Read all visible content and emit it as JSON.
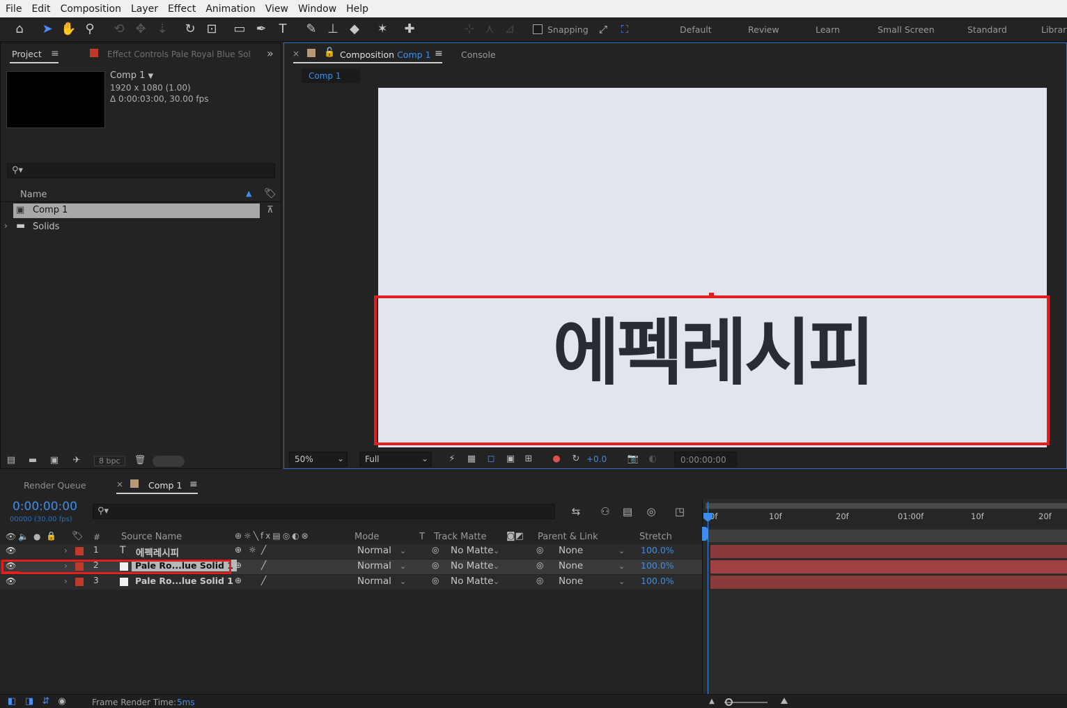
{
  "menu": [
    "File",
    "Edit",
    "Composition",
    "Layer",
    "Effect",
    "Animation",
    "View",
    "Window",
    "Help"
  ],
  "toolbar": {
    "snapping_label": "Snapping",
    "workspaces": [
      "Default",
      "Review",
      "Learn",
      "Small Screen",
      "Standard",
      "Librar"
    ]
  },
  "project_panel": {
    "tab_label": "Project",
    "effect_controls_label": "Effect Controls",
    "effect_controls_target": "Pale Royal Blue Sol",
    "comp_name": "Comp 1",
    "comp_size": "1920 x 1080 (1.00)",
    "comp_duration": "Δ 0:00:03:00, 30.00 fps",
    "search_placeholder": "",
    "name_header": "Name",
    "items": [
      "Comp 1",
      "Solids"
    ],
    "bpc": "8 bpc"
  },
  "comp_panel": {
    "tab_prefix": "Composition",
    "tab_comp": "Comp 1",
    "console_tab": "Console",
    "sub_tab": "Comp 1",
    "text": "에펙레시피",
    "zoom": "50%",
    "resolution": "Full",
    "exposure": "+0.0",
    "timecode": "0:00:00:00"
  },
  "timeline": {
    "render_queue_tab": "Render Queue",
    "comp_tab": "Comp 1",
    "timecode": "0:00:00:00",
    "frames": "00000 (30.00 fps)",
    "headers": {
      "num": "#",
      "source": "Source Name",
      "mode": "Mode",
      "t": "T",
      "track_matte": "Track Matte",
      "parent": "Parent & Link",
      "stretch": "Stretch"
    },
    "ruler": [
      "0f",
      "10f",
      "20f",
      "01:00f",
      "10f",
      "20f"
    ],
    "layers": [
      {
        "num": "1",
        "type": "T",
        "name": "에펙레시피",
        "mode": "Normal",
        "matte": "No Matte",
        "parent": "None",
        "stretch": "100.0%"
      },
      {
        "num": "2",
        "type": "solid",
        "name": "Pale Ro...lue Solid 1",
        "mode": "Normal",
        "matte": "No Matte",
        "parent": "None",
        "stretch": "100.0%"
      },
      {
        "num": "3",
        "type": "solid",
        "name": "Pale Ro...lue Solid 1",
        "mode": "Normal",
        "matte": "No Matte",
        "parent": "None",
        "stretch": "100.0%"
      }
    ],
    "footer_label": "Frame Render Time:",
    "footer_value": "5ms"
  },
  "colors": {
    "accent": "#3d8eea",
    "highlight": "#e02020",
    "label_red": "#c0392b",
    "comp_bg": "#e2e5ee",
    "layer_bar": "#8b3a3a"
  }
}
